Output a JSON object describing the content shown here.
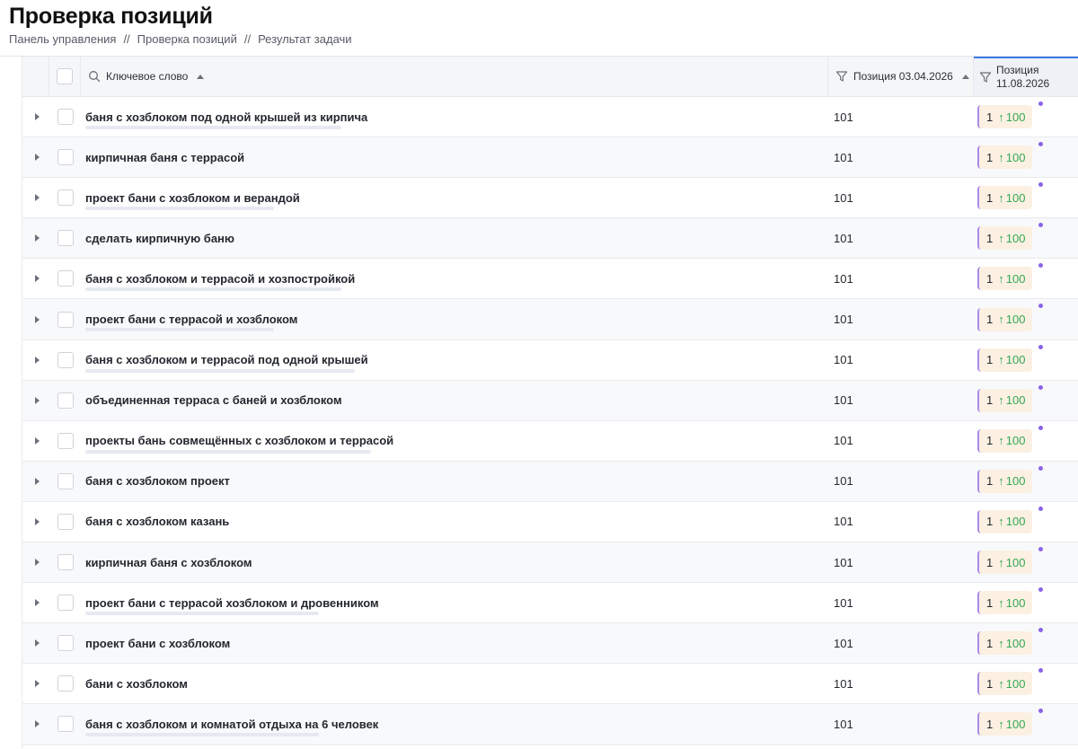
{
  "page": {
    "title": "Проверка позиций"
  },
  "breadcrumb": {
    "items": [
      "Панель управления",
      "Проверка позиций",
      "Результат задачи"
    ],
    "separator": "//"
  },
  "table": {
    "columns": {
      "keyword": "Ключевое слово",
      "position_1": "Позиция 03.04.2026",
      "position_2_line1": "Позиция",
      "position_2_line2": "11.08.2026"
    },
    "icons": {
      "search": "search-icon",
      "filter": "filter-icon",
      "sort": "sort-ascending-icon",
      "expand": "chevron-right-icon",
      "change_up": "arrow-up-icon"
    },
    "colors": {
      "change_positive": "#34a853",
      "badge_background": "#fbf0e2",
      "badge_accent": "#a98ae6",
      "active_column": "#3d7de4"
    },
    "rows": [
      {
        "keyword": "баня с хозблоком под одной крышей из кирпича",
        "pos1": "101",
        "pos2": "1",
        "change": "100"
      },
      {
        "keyword": "кирпичная баня с террасой",
        "pos1": "101",
        "pos2": "1",
        "change": "100"
      },
      {
        "keyword": "проект бани с хозблоком и верандой",
        "pos1": "101",
        "pos2": "1",
        "change": "100"
      },
      {
        "keyword": "сделать кирпичную баню",
        "pos1": "101",
        "pos2": "1",
        "change": "100"
      },
      {
        "keyword": "баня с хозблоком и террасой и хозпостройкой",
        "pos1": "101",
        "pos2": "1",
        "change": "100"
      },
      {
        "keyword": "проект бани с террасой и хозблоком",
        "pos1": "101",
        "pos2": "1",
        "change": "100"
      },
      {
        "keyword": "баня с хозблоком и террасой под одной крышей",
        "pos1": "101",
        "pos2": "1",
        "change": "100"
      },
      {
        "keyword": "объединенная терраса с баней и хозблоком",
        "pos1": "101",
        "pos2": "1",
        "change": "100"
      },
      {
        "keyword": "проекты бань совмещённых с хозблоком и террасой",
        "pos1": "101",
        "pos2": "1",
        "change": "100"
      },
      {
        "keyword": "баня с хозблоком проект",
        "pos1": "101",
        "pos2": "1",
        "change": "100"
      },
      {
        "keyword": "баня с хозблоком казань",
        "pos1": "101",
        "pos2": "1",
        "change": "100"
      },
      {
        "keyword": "кирпичная баня с хозблоком",
        "pos1": "101",
        "pos2": "1",
        "change": "100"
      },
      {
        "keyword": "проект бани с террасой хозблоком и дровенником",
        "pos1": "101",
        "pos2": "1",
        "change": "100"
      },
      {
        "keyword": "проект бани с хозблоком",
        "pos1": "101",
        "pos2": "1",
        "change": "100"
      },
      {
        "keyword": "бани с хозблоком",
        "pos1": "101",
        "pos2": "1",
        "change": "100"
      },
      {
        "keyword": "баня с хозблоком и комнатой отдыха на 6 человек",
        "pos1": "101",
        "pos2": "1",
        "change": "100"
      }
    ]
  }
}
